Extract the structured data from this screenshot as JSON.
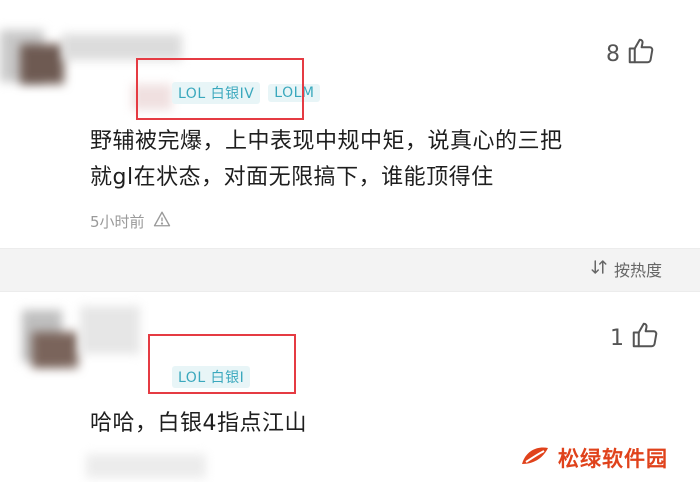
{
  "comment1": {
    "like_count": "8",
    "tags": [
      "LOL 白银IV",
      "LOLM"
    ],
    "text_line1": "野辅被完爆，上中表现中规中矩，说真心的三把",
    "text_line2": "就gl在状态，对面无限搞下，谁能顶得住",
    "time": "5小时前"
  },
  "sort_bar": {
    "label": "按热度"
  },
  "comment2": {
    "like_count": "1",
    "tags": [
      "LOL 白银I"
    ],
    "text": "哈哈，白银4指点江山"
  },
  "watermark": {
    "text": "松绿软件园"
  },
  "colors": {
    "tag_bg": "#e8f5f7",
    "tag_fg": "#3aa8bd",
    "highlight_box": "#e53b43",
    "brand": "#e0421b"
  }
}
